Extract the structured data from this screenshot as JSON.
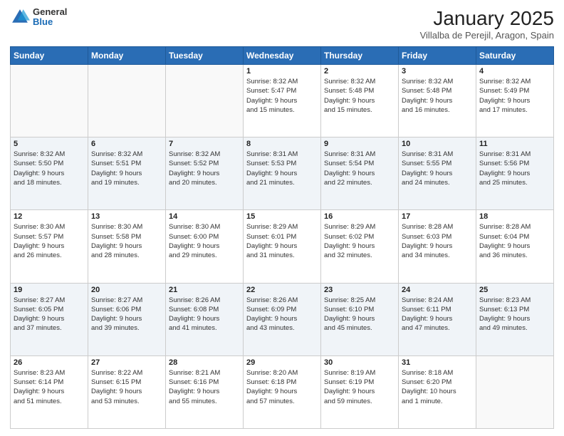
{
  "logo": {
    "general": "General",
    "blue": "Blue"
  },
  "header": {
    "title": "January 2025",
    "subtitle": "Villalba de Perejil, Aragon, Spain"
  },
  "weekdays": [
    "Sunday",
    "Monday",
    "Tuesday",
    "Wednesday",
    "Thursday",
    "Friday",
    "Saturday"
  ],
  "weeks": [
    [
      {
        "day": "",
        "info": ""
      },
      {
        "day": "",
        "info": ""
      },
      {
        "day": "",
        "info": ""
      },
      {
        "day": "1",
        "info": "Sunrise: 8:32 AM\nSunset: 5:47 PM\nDaylight: 9 hours\nand 15 minutes."
      },
      {
        "day": "2",
        "info": "Sunrise: 8:32 AM\nSunset: 5:48 PM\nDaylight: 9 hours\nand 15 minutes."
      },
      {
        "day": "3",
        "info": "Sunrise: 8:32 AM\nSunset: 5:48 PM\nDaylight: 9 hours\nand 16 minutes."
      },
      {
        "day": "4",
        "info": "Sunrise: 8:32 AM\nSunset: 5:49 PM\nDaylight: 9 hours\nand 17 minutes."
      }
    ],
    [
      {
        "day": "5",
        "info": "Sunrise: 8:32 AM\nSunset: 5:50 PM\nDaylight: 9 hours\nand 18 minutes."
      },
      {
        "day": "6",
        "info": "Sunrise: 8:32 AM\nSunset: 5:51 PM\nDaylight: 9 hours\nand 19 minutes."
      },
      {
        "day": "7",
        "info": "Sunrise: 8:32 AM\nSunset: 5:52 PM\nDaylight: 9 hours\nand 20 minutes."
      },
      {
        "day": "8",
        "info": "Sunrise: 8:31 AM\nSunset: 5:53 PM\nDaylight: 9 hours\nand 21 minutes."
      },
      {
        "day": "9",
        "info": "Sunrise: 8:31 AM\nSunset: 5:54 PM\nDaylight: 9 hours\nand 22 minutes."
      },
      {
        "day": "10",
        "info": "Sunrise: 8:31 AM\nSunset: 5:55 PM\nDaylight: 9 hours\nand 24 minutes."
      },
      {
        "day": "11",
        "info": "Sunrise: 8:31 AM\nSunset: 5:56 PM\nDaylight: 9 hours\nand 25 minutes."
      }
    ],
    [
      {
        "day": "12",
        "info": "Sunrise: 8:30 AM\nSunset: 5:57 PM\nDaylight: 9 hours\nand 26 minutes."
      },
      {
        "day": "13",
        "info": "Sunrise: 8:30 AM\nSunset: 5:58 PM\nDaylight: 9 hours\nand 28 minutes."
      },
      {
        "day": "14",
        "info": "Sunrise: 8:30 AM\nSunset: 6:00 PM\nDaylight: 9 hours\nand 29 minutes."
      },
      {
        "day": "15",
        "info": "Sunrise: 8:29 AM\nSunset: 6:01 PM\nDaylight: 9 hours\nand 31 minutes."
      },
      {
        "day": "16",
        "info": "Sunrise: 8:29 AM\nSunset: 6:02 PM\nDaylight: 9 hours\nand 32 minutes."
      },
      {
        "day": "17",
        "info": "Sunrise: 8:28 AM\nSunset: 6:03 PM\nDaylight: 9 hours\nand 34 minutes."
      },
      {
        "day": "18",
        "info": "Sunrise: 8:28 AM\nSunset: 6:04 PM\nDaylight: 9 hours\nand 36 minutes."
      }
    ],
    [
      {
        "day": "19",
        "info": "Sunrise: 8:27 AM\nSunset: 6:05 PM\nDaylight: 9 hours\nand 37 minutes."
      },
      {
        "day": "20",
        "info": "Sunrise: 8:27 AM\nSunset: 6:06 PM\nDaylight: 9 hours\nand 39 minutes."
      },
      {
        "day": "21",
        "info": "Sunrise: 8:26 AM\nSunset: 6:08 PM\nDaylight: 9 hours\nand 41 minutes."
      },
      {
        "day": "22",
        "info": "Sunrise: 8:26 AM\nSunset: 6:09 PM\nDaylight: 9 hours\nand 43 minutes."
      },
      {
        "day": "23",
        "info": "Sunrise: 8:25 AM\nSunset: 6:10 PM\nDaylight: 9 hours\nand 45 minutes."
      },
      {
        "day": "24",
        "info": "Sunrise: 8:24 AM\nSunset: 6:11 PM\nDaylight: 9 hours\nand 47 minutes."
      },
      {
        "day": "25",
        "info": "Sunrise: 8:23 AM\nSunset: 6:13 PM\nDaylight: 9 hours\nand 49 minutes."
      }
    ],
    [
      {
        "day": "26",
        "info": "Sunrise: 8:23 AM\nSunset: 6:14 PM\nDaylight: 9 hours\nand 51 minutes."
      },
      {
        "day": "27",
        "info": "Sunrise: 8:22 AM\nSunset: 6:15 PM\nDaylight: 9 hours\nand 53 minutes."
      },
      {
        "day": "28",
        "info": "Sunrise: 8:21 AM\nSunset: 6:16 PM\nDaylight: 9 hours\nand 55 minutes."
      },
      {
        "day": "29",
        "info": "Sunrise: 8:20 AM\nSunset: 6:18 PM\nDaylight: 9 hours\nand 57 minutes."
      },
      {
        "day": "30",
        "info": "Sunrise: 8:19 AM\nSunset: 6:19 PM\nDaylight: 9 hours\nand 59 minutes."
      },
      {
        "day": "31",
        "info": "Sunrise: 8:18 AM\nSunset: 6:20 PM\nDaylight: 10 hours\nand 1 minute."
      },
      {
        "day": "",
        "info": ""
      }
    ]
  ]
}
